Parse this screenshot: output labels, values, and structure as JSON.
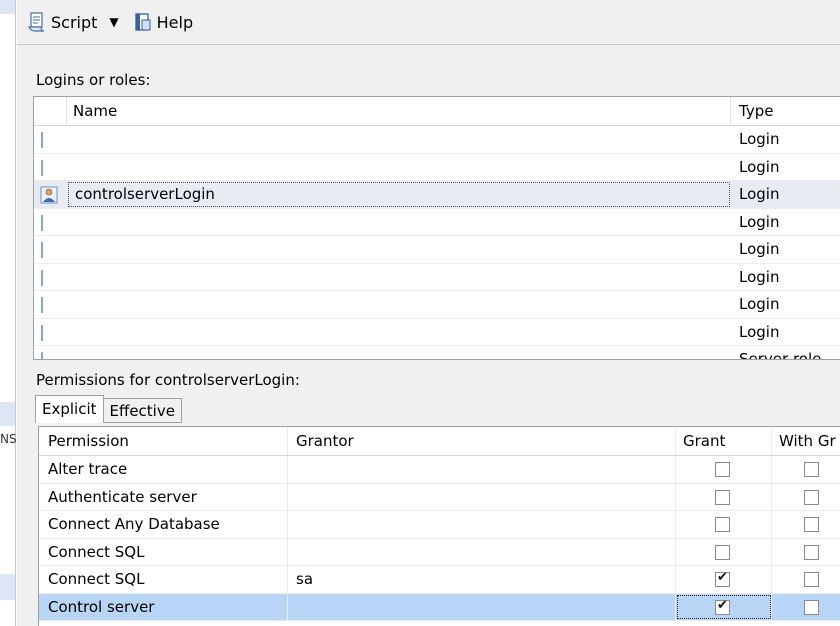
{
  "toolbar": {
    "script_label": "Script",
    "help_label": "Help"
  },
  "left_strip": {
    "partial_text": "NS"
  },
  "logins": {
    "section_label": "Logins or roles:",
    "columns": {
      "name": "Name",
      "type": "Type"
    },
    "rows": [
      {
        "name": "",
        "type": "Login"
      },
      {
        "name": "",
        "type": "Login"
      },
      {
        "name": "controlserverLogin",
        "type": "Login",
        "selected": true
      },
      {
        "name": "",
        "type": "Login"
      },
      {
        "name": "",
        "type": "Login"
      },
      {
        "name": "",
        "type": "Login"
      },
      {
        "name": "",
        "type": "Login"
      },
      {
        "name": "",
        "type": "Login"
      },
      {
        "name": "",
        "type": "Server role"
      }
    ]
  },
  "permissions": {
    "section_label": "Permissions for controlserverLogin:",
    "tabs": [
      {
        "label": "Explicit",
        "active": true
      },
      {
        "label": "Effective",
        "active": false
      }
    ],
    "columns": {
      "permission": "Permission",
      "grantor": "Grantor",
      "grant": "Grant",
      "with_grant": "With Gr"
    },
    "rows": [
      {
        "permission": "Alter trace",
        "grantor": "",
        "grant": false,
        "with_grant": false
      },
      {
        "permission": "Authenticate server",
        "grantor": "",
        "grant": false,
        "with_grant": false
      },
      {
        "permission": "Connect Any Database",
        "grantor": "",
        "grant": false,
        "with_grant": false
      },
      {
        "permission": "Connect SQL",
        "grantor": "",
        "grant": false,
        "with_grant": false
      },
      {
        "permission": "Connect SQL",
        "grantor": "sa",
        "grant": true,
        "with_grant": false
      },
      {
        "permission": "Control server",
        "grantor": "",
        "grant": true,
        "with_grant": false,
        "selected": true
      }
    ]
  }
}
